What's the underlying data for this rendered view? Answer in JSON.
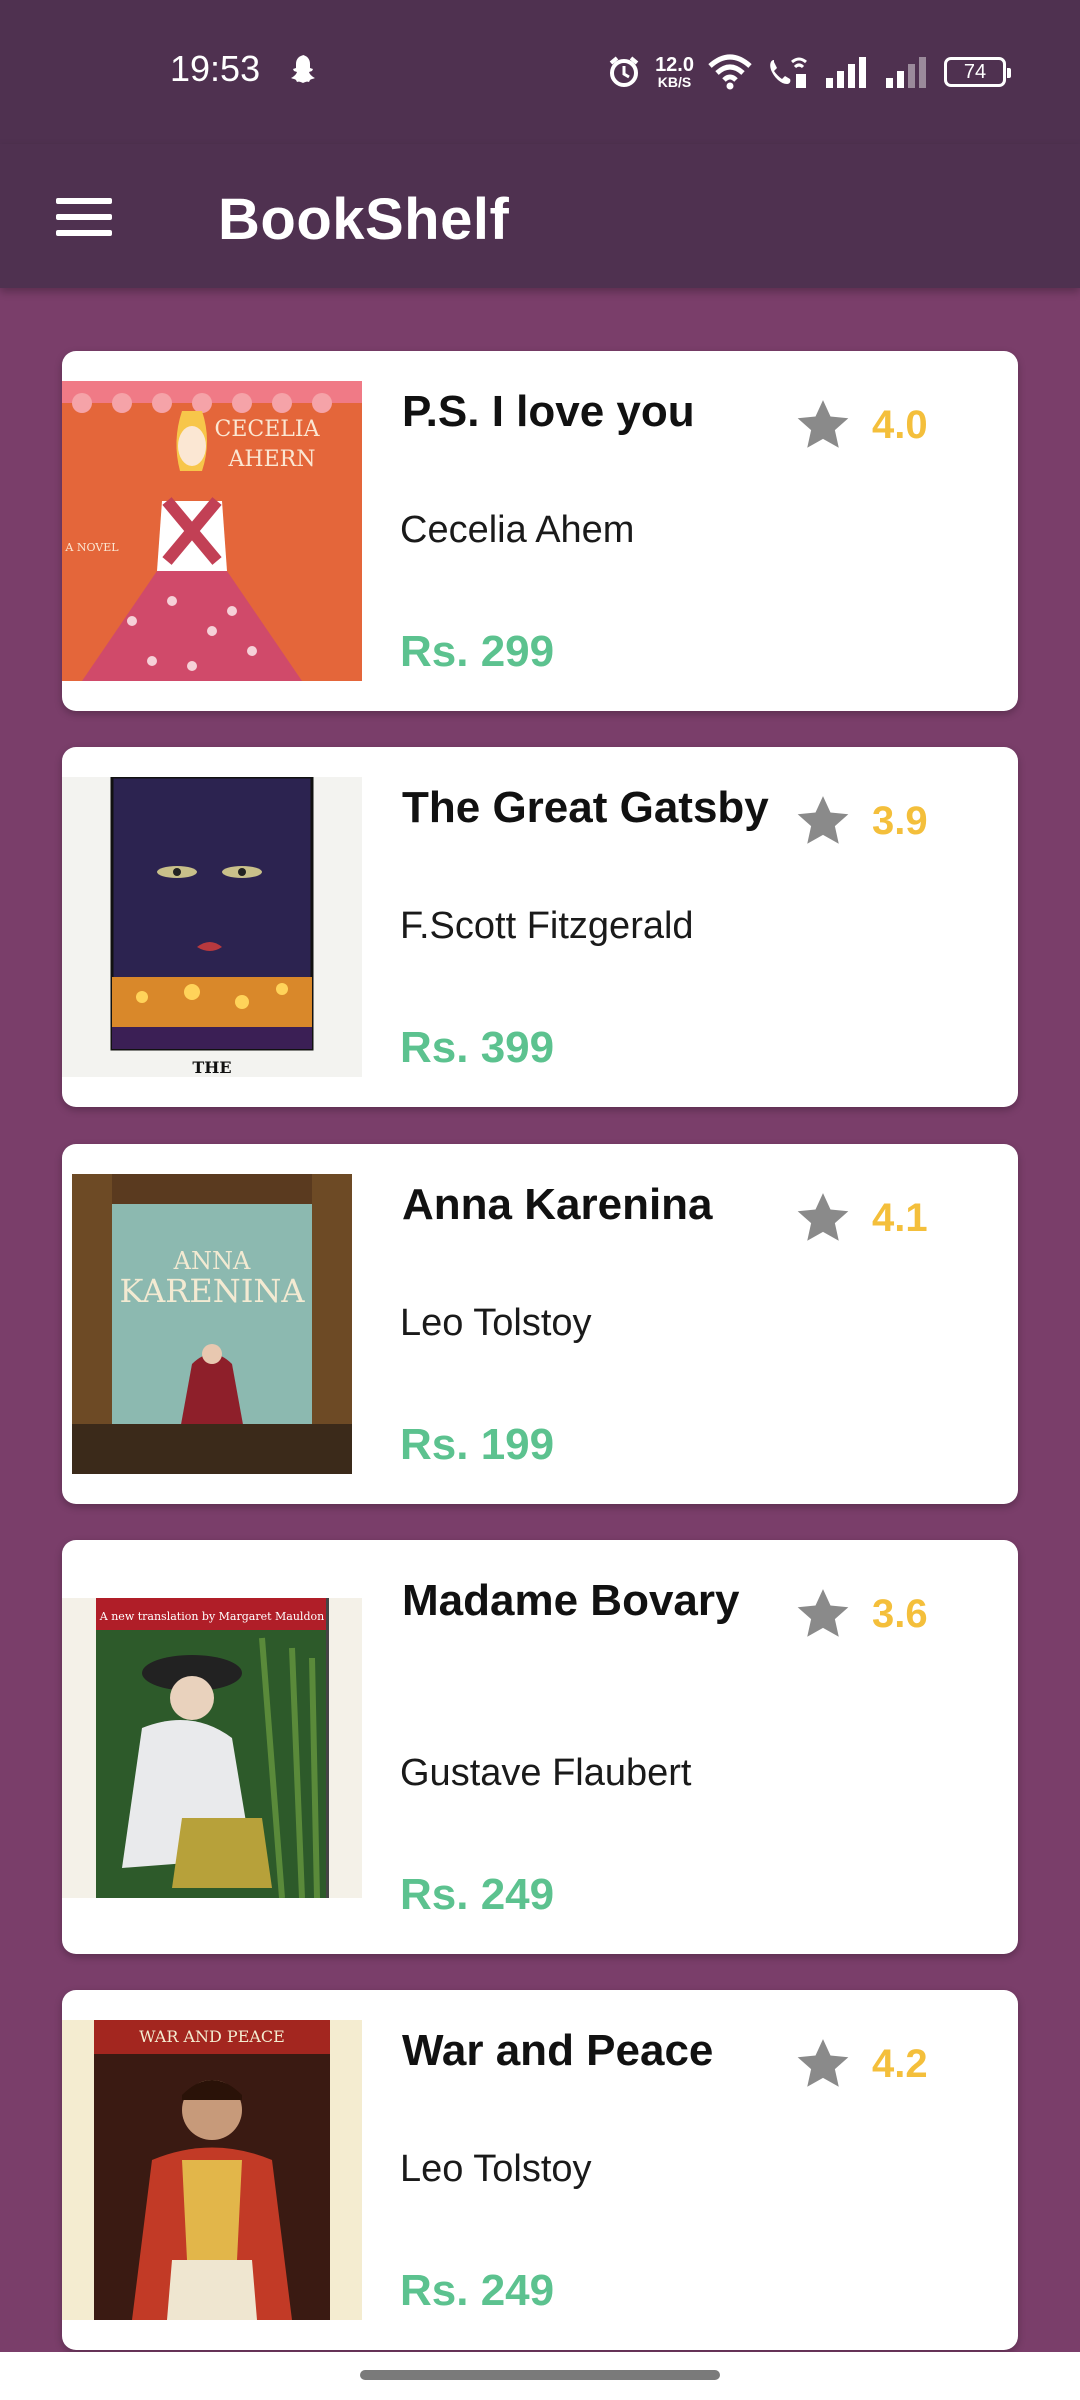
{
  "status_bar": {
    "time": "19:53",
    "net_speed_value": "12.0",
    "net_speed_unit": "KB/S",
    "battery": "74"
  },
  "app_bar": {
    "title": "BookShelf",
    "menu_icon": "hamburger-menu-icon"
  },
  "books": [
    {
      "title": "P.S. I love you",
      "author": "Cecelia Ahem",
      "price": "Rs. 299",
      "rating": "4.0"
    },
    {
      "title": "The Great Gatsby",
      "author": "F.Scott Fitzgerald",
      "price": "Rs. 399",
      "rating": "3.9"
    },
    {
      "title": "Anna Karenina",
      "author": "Leo Tolstoy",
      "price": "Rs. 199",
      "rating": "4.1"
    },
    {
      "title": "Madame Bovary",
      "author": "Gustave Flaubert",
      "price": "Rs. 249",
      "rating": "3.6"
    },
    {
      "title": "War and Peace",
      "author": "Leo Tolstoy",
      "price": "Rs. 249",
      "rating": "4.2"
    }
  ],
  "cover_text": {
    "ps_author_1": "CECELIA",
    "ps_author_2": "AHERN",
    "ps_label": "A NOVEL",
    "gatsby_label": "THE",
    "anna_title_1": "ANNA",
    "anna_title_2": "KARENINA",
    "bovary_banner": "A new translation by Margaret Mauldon",
    "war_banner": "WAR AND PEACE"
  },
  "colors": {
    "app_bar": "#4f3150",
    "background": "#7a3e6a",
    "price": "#5cc28f",
    "rating": "#f4bf3b",
    "star": "#8a8a8a"
  }
}
